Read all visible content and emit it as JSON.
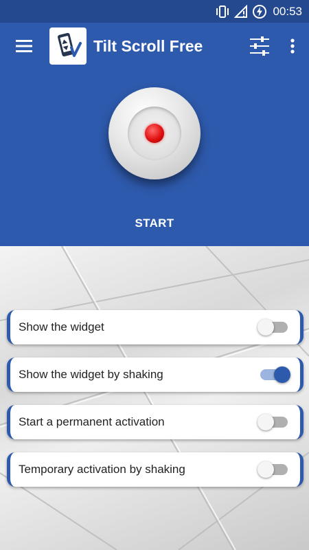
{
  "status_bar": {
    "time": "00:53",
    "icons": [
      "vibrate-icon",
      "signal-icon",
      "battery-charging-icon"
    ]
  },
  "app_bar": {
    "title": "Tilt Scroll Free",
    "icons": [
      "menu-icon",
      "app-logo-icon",
      "tune-icon",
      "more-vert-icon"
    ]
  },
  "hero": {
    "start_label": "START"
  },
  "settings": {
    "items": [
      {
        "label": "Show the widget",
        "enabled": false
      },
      {
        "label": "Show the widget by shaking",
        "enabled": true
      },
      {
        "label": "Start a permanent activation",
        "enabled": false
      },
      {
        "label": "Temporary activation by shaking",
        "enabled": false
      }
    ]
  },
  "colors": {
    "primary": "#2e5aad",
    "status_bar": "#24498f",
    "accent_dot": "#e01010",
    "toggle_on_thumb": "#2e5aad",
    "toggle_on_track": "#9db4e0",
    "toggle_off_track": "#b0b0b0"
  }
}
